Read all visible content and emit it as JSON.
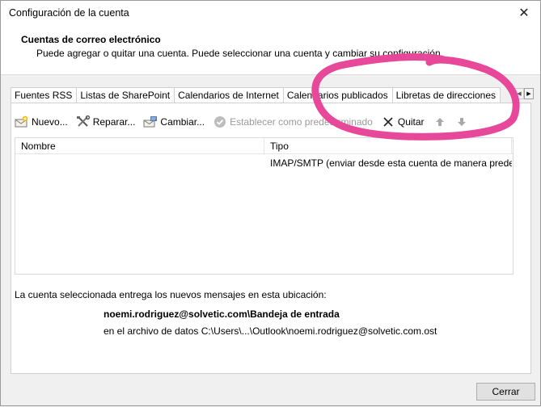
{
  "window": {
    "title": "Configuración de la cuenta",
    "close_glyph": "✕"
  },
  "header": {
    "title": "Cuentas de correo electrónico",
    "subtitle": "Puede agregar o quitar una cuenta. Puede seleccionar una cuenta y cambiar su configuración."
  },
  "tabs": [
    {
      "label": "Fuentes RSS"
    },
    {
      "label": "Listas de SharePoint"
    },
    {
      "label": "Calendarios de Internet"
    },
    {
      "label": "Calendarios publicados"
    },
    {
      "label": "Libretas de direcciones"
    }
  ],
  "tab_scroll": {
    "left": "◀",
    "right": "▶"
  },
  "toolbar": {
    "new_label": "Nuevo...",
    "repair_label": "Reparar...",
    "change_label": "Cambiar...",
    "set_default_label": "Establecer como predeterminado",
    "remove_label": "Quitar"
  },
  "list": {
    "columns": [
      "Nombre",
      "Tipo"
    ],
    "rows": [
      {
        "name": "",
        "type": "IMAP/SMTP (enviar desde esta cuenta de manera predet..."
      }
    ]
  },
  "info": {
    "delivery_text": "La cuenta seleccionada entrega los nuevos mensajes en esta ubicación:",
    "account": "noemi.rodriguez@solvetic.com\\Bandeja de entrada",
    "data_file": "en el archivo de datos C:\\Users\\...\\Outlook\\noemi.rodriguez@solvetic.com.ost"
  },
  "footer": {
    "close_label": "Cerrar"
  },
  "colors": {
    "annotation": "#e8489a",
    "disabled": "#9a9a9a"
  },
  "icons": [
    "close-icon",
    "new-account-icon",
    "repair-icon",
    "change-icon",
    "check-circle-icon",
    "remove-x-icon",
    "arrow-up-icon",
    "arrow-down-icon"
  ]
}
